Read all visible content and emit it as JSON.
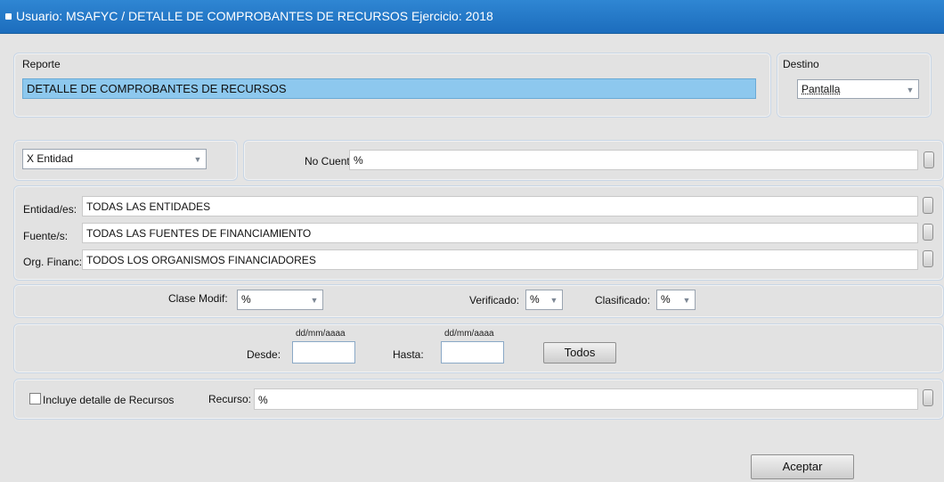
{
  "window": {
    "title": "Usuario: MSAFYC  /  DETALLE DE COMPROBANTES DE RECURSOS  Ejercicio: 2018"
  },
  "reporte": {
    "label": "Reporte",
    "value": "DETALLE DE COMPROBANTES DE RECURSOS"
  },
  "destino": {
    "label": "Destino",
    "selected": "Pantalla"
  },
  "filtro": {
    "selected": "X Entidad",
    "cuenta_label": "No Cuenta:",
    "cuenta_value": "%"
  },
  "entidades": {
    "rows": [
      {
        "label": "Entidad/es:",
        "value": "TODAS LAS ENTIDADES"
      },
      {
        "label": "Fuente/s:",
        "value": "TODAS LAS FUENTES DE FINANCIAMIENTO"
      },
      {
        "label": "Org. Financ:",
        "value": "TODOS LOS ORGANISMOS FINANCIADORES"
      }
    ]
  },
  "clase": {
    "clase_label": "Clase Modif:",
    "clase_value": "%",
    "verificado_label": "Verificado:",
    "verificado_value": "%",
    "clasificado_label": "Clasificado:",
    "clasificado_value": "%"
  },
  "fechas": {
    "desde_label": "Desde:",
    "hasta_label": "Hasta:",
    "format_hint": "dd/mm/aaaa",
    "desde_value": "",
    "hasta_value": "",
    "todos_label": "Todos"
  },
  "recurso": {
    "checkbox_label": "Incluye detalle de Recursos",
    "checked": false,
    "recurso_label": "Recurso:",
    "recurso_value": "%"
  },
  "footer": {
    "aceptar_label": "Aceptar"
  },
  "colors": {
    "titlebar": "#1f74c4",
    "selected_field": "#8dc8ee"
  }
}
